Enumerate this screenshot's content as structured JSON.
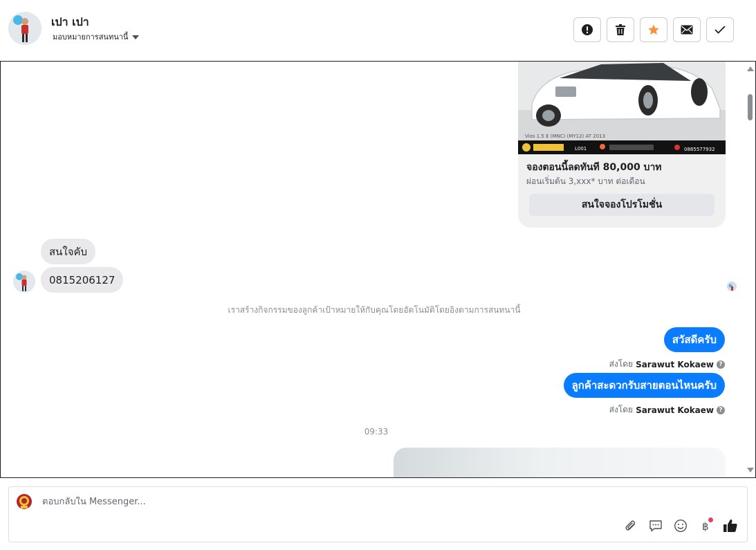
{
  "header": {
    "contact_name": "เปา เปา",
    "assign_label": "มอบหมายการสนทนานี้",
    "actions": [
      "spam-icon",
      "trash-icon",
      "star-icon",
      "mail-icon",
      "check-icon"
    ],
    "star_color": "#f7923b"
  },
  "card": {
    "image_caption": "Vios 1.5 E (MNC) (MY12) AT 2013",
    "image_code": "L001",
    "image_phone": "0885577932",
    "title": "จองตอนนี้ลดทันที 80,000 บาท",
    "subtitle": "ผ่อนเริ่มต้น 3,xxx* บาท ต่อเดือน",
    "button_label": "สนใจจองโปรโมชั่น"
  },
  "messages_in": [
    {
      "text": "สนใจคับ"
    },
    {
      "text": "0815206127"
    }
  ],
  "notice": "เราสร้างกิจกรรมของลูกค้าเป้าหมายให้กับคุณโดยอัตโนมัติโดยอิงตามการสนทนานี้",
  "messages_out": [
    {
      "text": "สวัสดีครับ",
      "sent_prefix": "ส่งโดย",
      "sender": "Sarawut Kokaew"
    },
    {
      "text": "ลูกค้าสะดวกรับสายตอนไหนครับ",
      "sent_prefix": "ส่งโดย",
      "sender": "Sarawut Kokaew"
    }
  ],
  "time": "09:33",
  "composer": {
    "placeholder": "ตอบกลับใน Messenger...",
    "tools": [
      "attach-icon",
      "saved-reply-icon",
      "emoji-icon",
      "baht-payment-icon",
      "thumbs-up-icon"
    ]
  },
  "colors": {
    "outgoing_bubble": "#0a7cff",
    "incoming_bubble": "#e9e9eb",
    "notification_dot": "#e4405f"
  }
}
